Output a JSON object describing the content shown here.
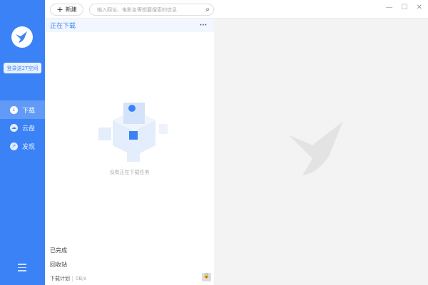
{
  "sidebar": {
    "login_label": "登录送2T空间",
    "items": [
      {
        "label": "下载",
        "icon": "download-icon",
        "active": true
      },
      {
        "label": "云盘",
        "icon": "cloud-icon"
      },
      {
        "label": "发现",
        "icon": "compass-icon"
      }
    ]
  },
  "toolbar": {
    "new_label": "新建",
    "search_placeholder": "输入网址、电影名等想要搜索的信息"
  },
  "list": {
    "tab_label": "正在下载",
    "more": "···",
    "empty_text": "没有正在下载任务",
    "completed": "已完成",
    "recycle": "回收站",
    "plan_label": "下载计划",
    "speed": "0B/s"
  },
  "colors": {
    "accent": "#3b82f6"
  }
}
